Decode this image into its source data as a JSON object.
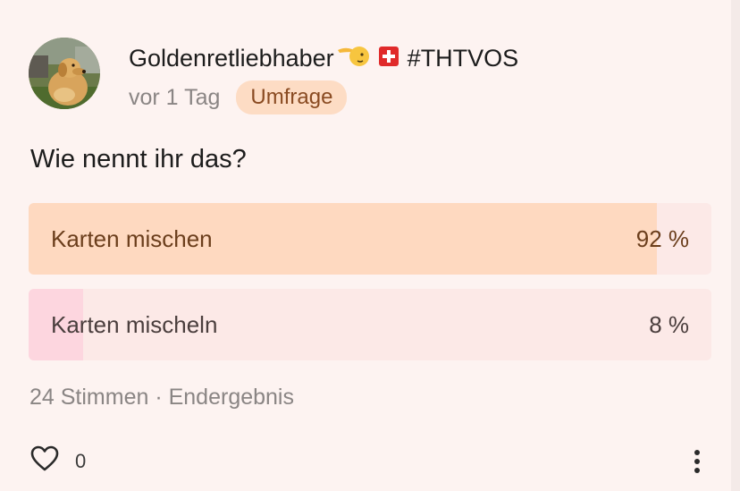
{
  "post": {
    "author": "Goldenretliebhaber",
    "hashtag": "#THTVOS",
    "time": "vor 1 Tag",
    "badge": "Umfrage",
    "question": "Wie nennt ihr das?"
  },
  "poll": {
    "options": [
      {
        "label": "Karten mischen",
        "percent_text": "92 %",
        "share": 0.92
      },
      {
        "label": "Karten mischeln",
        "percent_text": "8 %",
        "share": 0.08
      }
    ],
    "summary": "24 Stimmen · Endergebnis"
  },
  "footer": {
    "like_count": "0",
    "like_icon": "heart-outline-icon",
    "more_icon": "vertical-dots-icon"
  },
  "colors": {
    "background": "#fdf3f1",
    "badge_bg": "#fddcc4",
    "winner_fill": "#fed9c0",
    "loser_fill": "#fdd6df"
  }
}
